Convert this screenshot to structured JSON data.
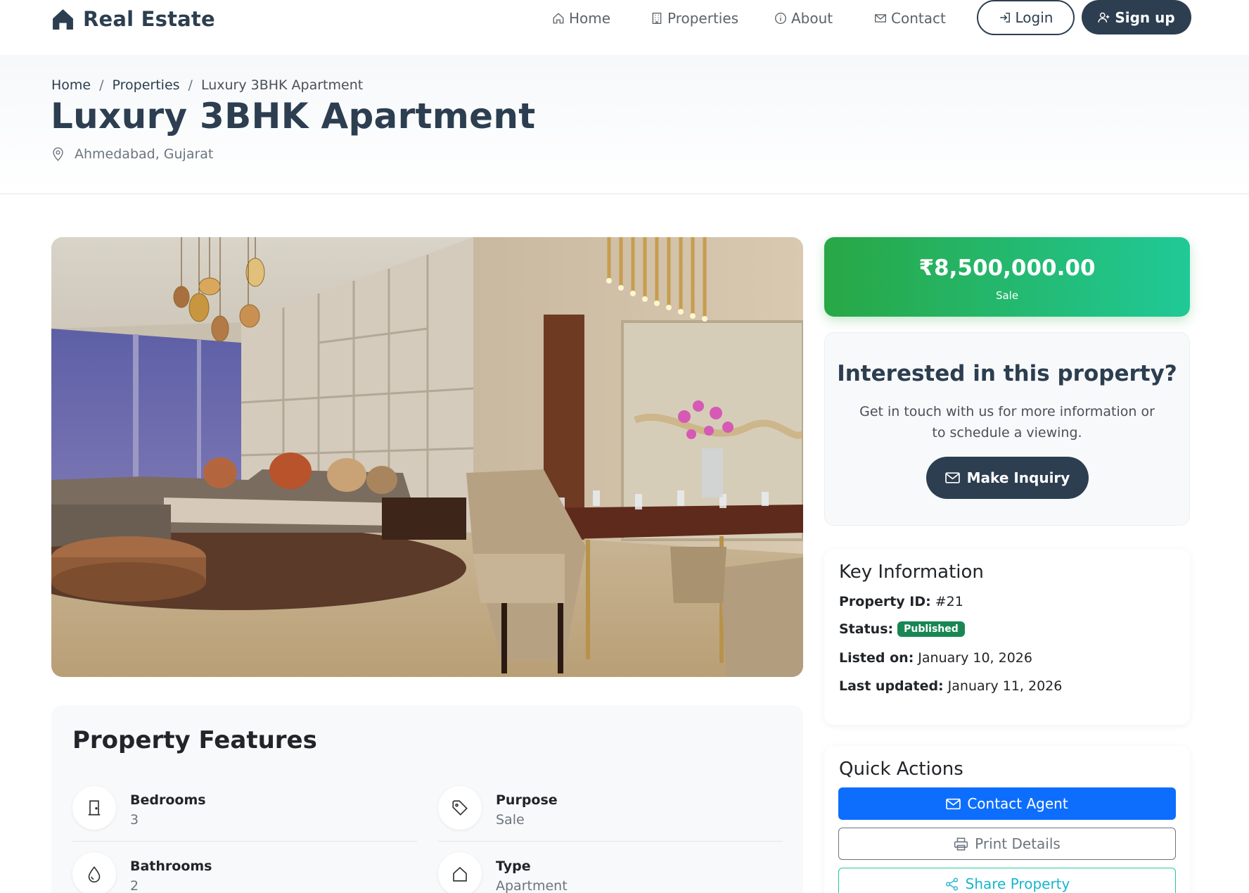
{
  "navbar": {
    "brand": "Real Estate",
    "links": [
      {
        "label": "Home",
        "icon": "house-icon"
      },
      {
        "label": "Properties",
        "icon": "building-icon"
      },
      {
        "label": "About",
        "icon": "info-circle-icon"
      },
      {
        "label": "Contact",
        "icon": "envelope-icon"
      }
    ],
    "login_label": "Login",
    "signup_label": "Sign up"
  },
  "breadcrumb": {
    "items": [
      "Home",
      "Properties",
      "Luxury 3BHK Apartment"
    ],
    "separator": "/"
  },
  "property": {
    "title": "Luxury 3BHK Apartment",
    "location": "Ahmedabad, Gujarat"
  },
  "price_card": {
    "price": "₹8,500,000.00",
    "type": "Sale"
  },
  "inquiry": {
    "title": "Interested in this property?",
    "text": "Get in touch with us for more information or to schedule a viewing.",
    "button_label": "Make Inquiry"
  },
  "key_info": {
    "title": "Key Information",
    "property_id_label": "Property ID:",
    "property_id": "#21",
    "status_label": "Status:",
    "status": "Published",
    "listed_label": "Listed on:",
    "listed": "January 10, 2026",
    "updated_label": "Last updated:",
    "updated": "January 11, 2026"
  },
  "features": {
    "title": "Property Features",
    "items": [
      {
        "label": "Bedrooms",
        "value": "3",
        "icon": "door-icon"
      },
      {
        "label": "Purpose",
        "value": "Sale",
        "icon": "tag-icon"
      },
      {
        "label": "Bathrooms",
        "value": "2",
        "icon": "droplet-icon"
      },
      {
        "label": "Type",
        "value": "Apartment",
        "icon": "house-icon"
      }
    ]
  },
  "quick_actions": {
    "title": "Quick Actions",
    "contact_label": "Contact Agent",
    "print_label": "Print Details",
    "share_label": "Share Property"
  },
  "colors": {
    "primary_dark": "#2c3e50",
    "price_gradient_start": "#28a745",
    "price_gradient_end": "#20c997",
    "contact_blue": "#0d6efd",
    "status_green": "#198754"
  }
}
